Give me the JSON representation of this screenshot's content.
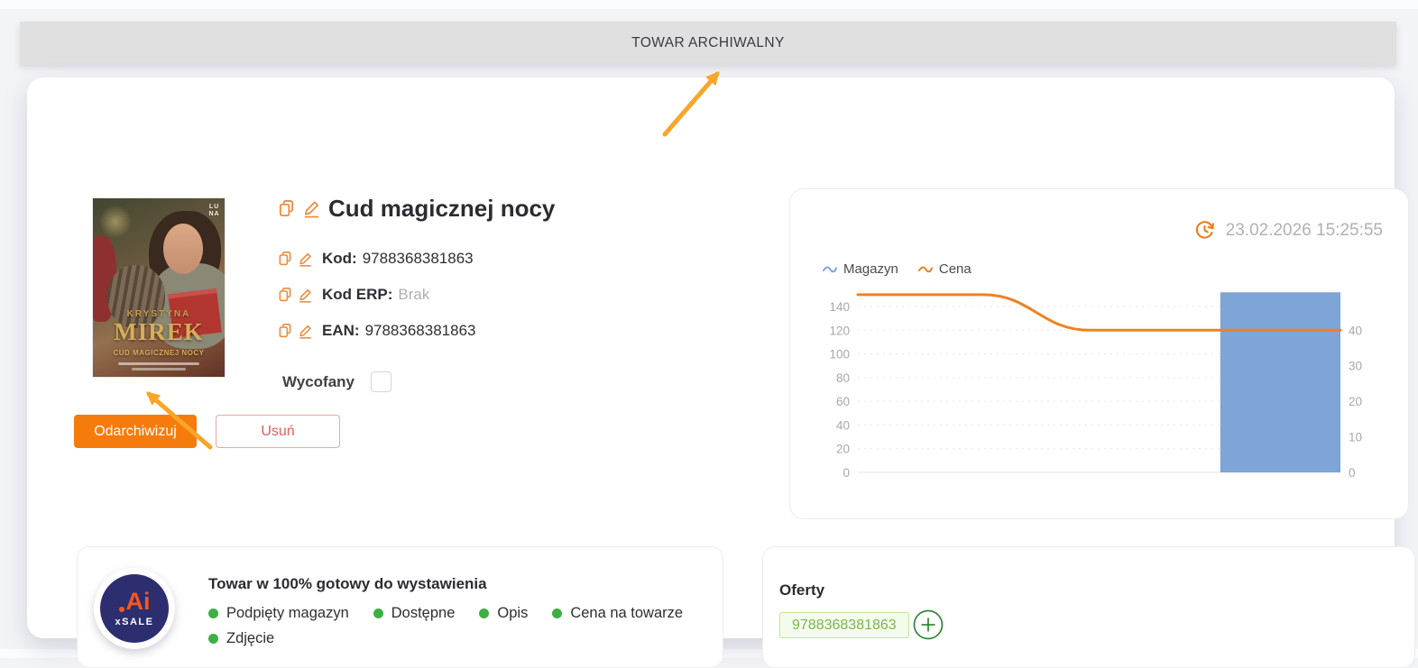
{
  "banner": {
    "text": "TOWAR ARCHIWALNY"
  },
  "product": {
    "title": "Cud magicznej nocy",
    "fields": [
      {
        "label": "Kod:",
        "value": "9788368381863"
      },
      {
        "label": "Kod ERP:",
        "value": "Brak"
      },
      {
        "label": "EAN:",
        "value": "9788368381863"
      }
    ],
    "withdrawn_label": "Wycofany",
    "withdrawn_checked": false,
    "buttons": {
      "unarchive": "Odarchiwizuj",
      "delete": "Usuń"
    },
    "cover": {
      "publisher": "LUNA",
      "author_first": "KRYSTYNA",
      "author_last": "MIREK",
      "title": "CUD MAGICZNEJ NOCY"
    }
  },
  "chart": {
    "timestamp": "23.02.2026 15:25:55",
    "legend": [
      {
        "label": "Magazyn",
        "color": "#7da5d8"
      },
      {
        "label": "Cena",
        "color": "#ef8122"
      }
    ]
  },
  "chart_data": {
    "type": "combo-bar-line",
    "title": "",
    "legend_position": "top-left",
    "grid": "dashed-horizontal",
    "left_axis": {
      "ticks": [
        0,
        20,
        40,
        60,
        80,
        100,
        120,
        140
      ],
      "range": [
        0,
        157.5
      ]
    },
    "right_axis": {
      "ticks": [
        0,
        10,
        20,
        30,
        40
      ],
      "range": [
        0,
        52.5
      ]
    },
    "series": [
      {
        "name": "Magazyn",
        "type": "bar",
        "axis": "left",
        "color": "#7da5d8",
        "x_span": [
          0.751,
          1.0
        ],
        "value": 152
      },
      {
        "name": "Cena",
        "type": "line",
        "axis": "right",
        "color": "#ef8122",
        "points": [
          {
            "x": 0,
            "y": 50
          },
          {
            "x": 0.26,
            "y": 50
          },
          {
            "x": 0.48,
            "y": 40
          },
          {
            "x": 1,
            "y": 40
          }
        ]
      }
    ]
  },
  "readiness": {
    "brand": {
      "ai": "Ai",
      "name": "xSALE"
    },
    "title": "Towar w 100% gotowy do wystawienia",
    "items": [
      "Podpięty magazyn",
      "Dostępne",
      "Opis",
      "Cena na towarze",
      "Zdjęcie"
    ]
  },
  "offers": {
    "title": "Oferty",
    "chips": [
      "9788368381863"
    ]
  },
  "colors": {
    "accent_orange": "#f57c0c",
    "arrow_orange": "#f7a62a",
    "icon_orange": "#ee8a3c",
    "delete_red": "#e05c5c",
    "success_green": "#3cb043",
    "chip_green_text": "#7ab648",
    "plus_green": "#2f8632",
    "banner_gray": "#e0e0e1",
    "bar_blue": "#7da5d8",
    "line_orange": "#ef8122"
  },
  "icons": {
    "copy": "copy-icon",
    "edit": "edit-pencil-icon",
    "clock": "history-clock-icon",
    "plus": "plus-circle-icon",
    "bullet": "green-dot-icon",
    "arrow": "annotation-arrow-icon"
  }
}
